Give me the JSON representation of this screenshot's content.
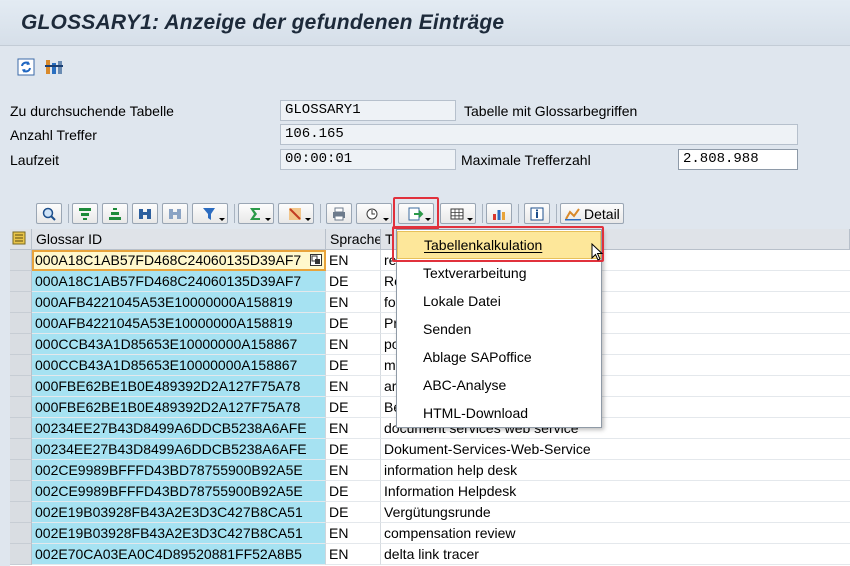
{
  "window": {
    "title": "GLOSSARY1: Anzeige der gefundenen Einträge"
  },
  "app_toolbar": {
    "icons": [
      "refresh-icon",
      "technical-settings-icon"
    ]
  },
  "form": {
    "table_label": "Zu durchsuchende Tabelle",
    "table_value": "GLOSSARY1",
    "table_desc": "Tabelle mit Glossarbegriffen",
    "hits_label": "Anzahl Treffer",
    "hits_value": "106.165",
    "runtime_label": "Laufzeit",
    "runtime_value": "00:00:01",
    "max_hits_label": "Maximale Trefferzahl",
    "max_hits_value": "2.808.988"
  },
  "alv_toolbar": {
    "detail_label": "Detail"
  },
  "grid": {
    "columns": [
      "Glossar ID",
      "Sprache",
      "T"
    ],
    "rows": [
      {
        "id": "000A18C1AB57FD468C24060135D39AF7",
        "lang": "EN",
        "text": "re"
      },
      {
        "id": "000A18C1AB57FD468C24060135D39AF7",
        "lang": "DE",
        "text": "Re"
      },
      {
        "id": "000AFB4221045A53E10000000A158819",
        "lang": "EN",
        "text": "fo"
      },
      {
        "id": "000AFB4221045A53E10000000A158819",
        "lang": "DE",
        "text": "Pr"
      },
      {
        "id": "000CCB43A1D85653E10000000A158867",
        "lang": "EN",
        "text": "po"
      },
      {
        "id": "000CCB43A1D85653E10000000A158867",
        "lang": "DE",
        "text": "m"
      },
      {
        "id": "000FBE62BE1B0E489392D2A127F75A78",
        "lang": "EN",
        "text": "ar"
      },
      {
        "id": "000FBE62BE1B0E489392D2A127F75A78",
        "lang": "DE",
        "text": "Be"
      },
      {
        "id": "00234EE27B43D8499A6DDCB5238A6AFE",
        "lang": "EN",
        "text": "document services web service"
      },
      {
        "id": "00234EE27B43D8499A6DDCB5238A6AFE",
        "lang": "DE",
        "text": "Dokument-Services-Web-Service"
      },
      {
        "id": "002CE9989BFFFD43BD78755900B92A5E",
        "lang": "EN",
        "text": "information help desk"
      },
      {
        "id": "002CE9989BFFFD43BD78755900B92A5E",
        "lang": "DE",
        "text": "Information Helpdesk"
      },
      {
        "id": "002E19B03928FB43A2E3D3C427B8CA51",
        "lang": "DE",
        "text": "Vergütungsrunde"
      },
      {
        "id": "002E19B03928FB43A2E3D3C427B8CA51",
        "lang": "EN",
        "text": "compensation review"
      },
      {
        "id": "002E70CA03EA0C4D89520881FF52A8B5",
        "lang": "EN",
        "text": "delta link tracer"
      }
    ]
  },
  "export_menu": {
    "items": [
      "Tabellenkalkulation",
      "Textverarbeitung",
      "Lokale Datei",
      "Senden",
      "Ablage SAPoffice",
      "ABC-Analyse",
      "HTML-Download"
    ]
  }
}
